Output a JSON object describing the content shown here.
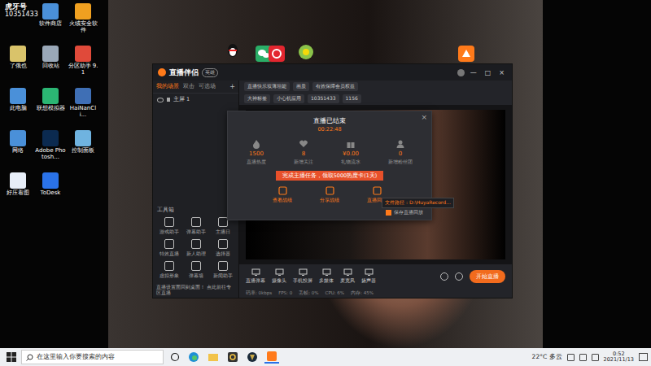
{
  "desktop": {
    "watermark": {
      "brand": "虎牙号",
      "id": "10351433"
    },
    "icons": [
      {
        "label": "软件商店"
      },
      {
        "label": "火绒安全软件"
      },
      {
        "label": "了俄也"
      },
      {
        "label": "回收站"
      },
      {
        "label": "分区助手 9.1"
      },
      {
        "label": "此电脑"
      },
      {
        "label": "联想模拟器"
      },
      {
        "label": "HaiNanCli..."
      },
      {
        "label": "网络"
      },
      {
        "label": "Adobe Photosh..."
      },
      {
        "label": "控制面板"
      },
      {
        "label": "好压看图"
      },
      {
        "label": "ToDesk"
      }
    ]
  },
  "app": {
    "title": "直播伴侣",
    "badge": "英雄",
    "window_controls": [
      "—",
      "□",
      "×"
    ],
    "scene_tabs": [
      {
        "label": "我的场景",
        "selected": true
      },
      {
        "label": "双击",
        "selected": false
      },
      {
        "label": "可选场",
        "selected": false
      }
    ],
    "add": "+",
    "scenes": [
      {
        "label": "主屏 1"
      }
    ],
    "chips": [
      "直播快乐双薄坦能",
      "画质",
      "有效保障会员权益"
    ],
    "chips2": [
      "大神标签",
      "小心机应用",
      "10351433",
      "1156"
    ],
    "toolbox_title": "工具箱",
    "tools": [
      {
        "label": "游戏助手"
      },
      {
        "label": "弹幕助手"
      },
      {
        "label": "主播日"
      },
      {
        "label": "特效直播"
      },
      {
        "label": "新人助理"
      },
      {
        "label": "选择器"
      },
      {
        "label": "虚拟形象"
      },
      {
        "label": "弹幕墙"
      },
      {
        "label": "新闻助手"
      }
    ],
    "notice": "直播设置面回到桌面！ 点此前往专区直播",
    "bottom_tools": [
      {
        "label": "直播弹幕"
      },
      {
        "label": "摄像头"
      },
      {
        "label": "手机投屏"
      },
      {
        "label": "多媒体"
      },
      {
        "label": "麦克风"
      },
      {
        "label": "扬声器"
      }
    ],
    "start_button": "开始直播",
    "status": [
      "码率: 0kbps",
      "FPS: 0",
      "丢帧: 0%",
      "CPU: 6%",
      "内存: 45%"
    ]
  },
  "dialog": {
    "title": "直播已结束",
    "duration": "00:22:48",
    "close": "×",
    "stats": [
      {
        "value": "1500",
        "label": "直播热度"
      },
      {
        "value": "8",
        "label": "新增关注"
      },
      {
        "value": "¥0.00",
        "label": "礼物流水"
      },
      {
        "value": "0",
        "label": "新增粉丝团"
      }
    ],
    "task_button": "完成主播任务，领取5000热度卡(1天)",
    "actions": [
      {
        "label": "查看战绩"
      },
      {
        "label": "分享战绩"
      },
      {
        "label": "直播回放"
      }
    ],
    "save_checkbox": {
      "label": "保存直播回放",
      "checked": true
    },
    "tooltip": "文件路径：D:\\HuyaRecord…"
  },
  "taskbar": {
    "search_placeholder": "在这里输入你要搜索的内容",
    "weather": "22°C 多云",
    "time": "0:52",
    "date": "2021/11/13"
  }
}
